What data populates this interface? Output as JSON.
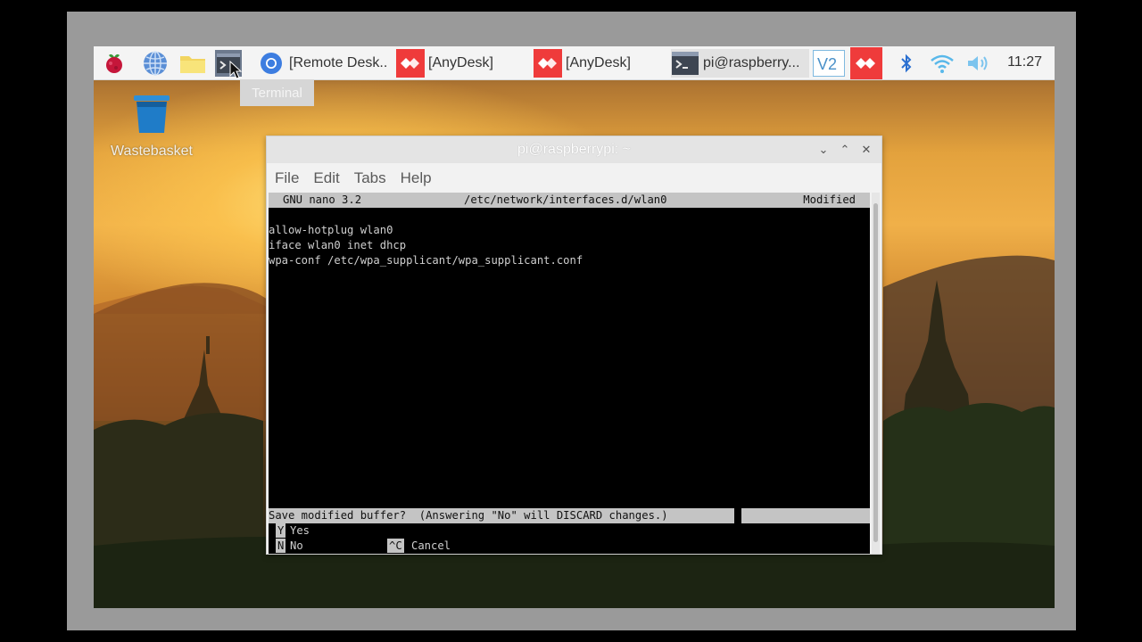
{
  "taskbar": {
    "tasks": [
      {
        "label": "[Remote Desk..",
        "icon": "chromium-icon"
      },
      {
        "label": "[AnyDesk]",
        "icon": "anydesk-icon"
      },
      {
        "label": "[AnyDesk]",
        "icon": "anydesk-icon"
      },
      {
        "label": "pi@raspberry...",
        "icon": "terminal-icon"
      }
    ],
    "clock": "11:27",
    "tooltip": "Terminal"
  },
  "desktop": {
    "wastebasket_label": "Wastebasket"
  },
  "window": {
    "title": "pi@raspberrypi: ~",
    "menu": [
      "File",
      "Edit",
      "Tabs",
      "Help"
    ]
  },
  "nano": {
    "version": "GNU nano 3.2",
    "filename": "/etc/network/interfaces.d/wlan0",
    "status": "Modified",
    "lines": [
      "allow-hotplug wlan0",
      "iface wlan0 inet dhcp",
      "wpa-conf /etc/wpa_supplicant/wpa_supplicant.conf"
    ],
    "prompt": "Save modified buffer?  (Answering \"No\" will DISCARD changes.)",
    "options": [
      {
        "key": "Y",
        "label": "Yes"
      },
      {
        "key": "N",
        "label": "No"
      },
      {
        "key": "^C",
        "label": "Cancel"
      }
    ]
  },
  "colors": {
    "anydesk": "#ef3b3b",
    "taskbar": "#f4f4f4",
    "terminal_bg": "#000000"
  }
}
